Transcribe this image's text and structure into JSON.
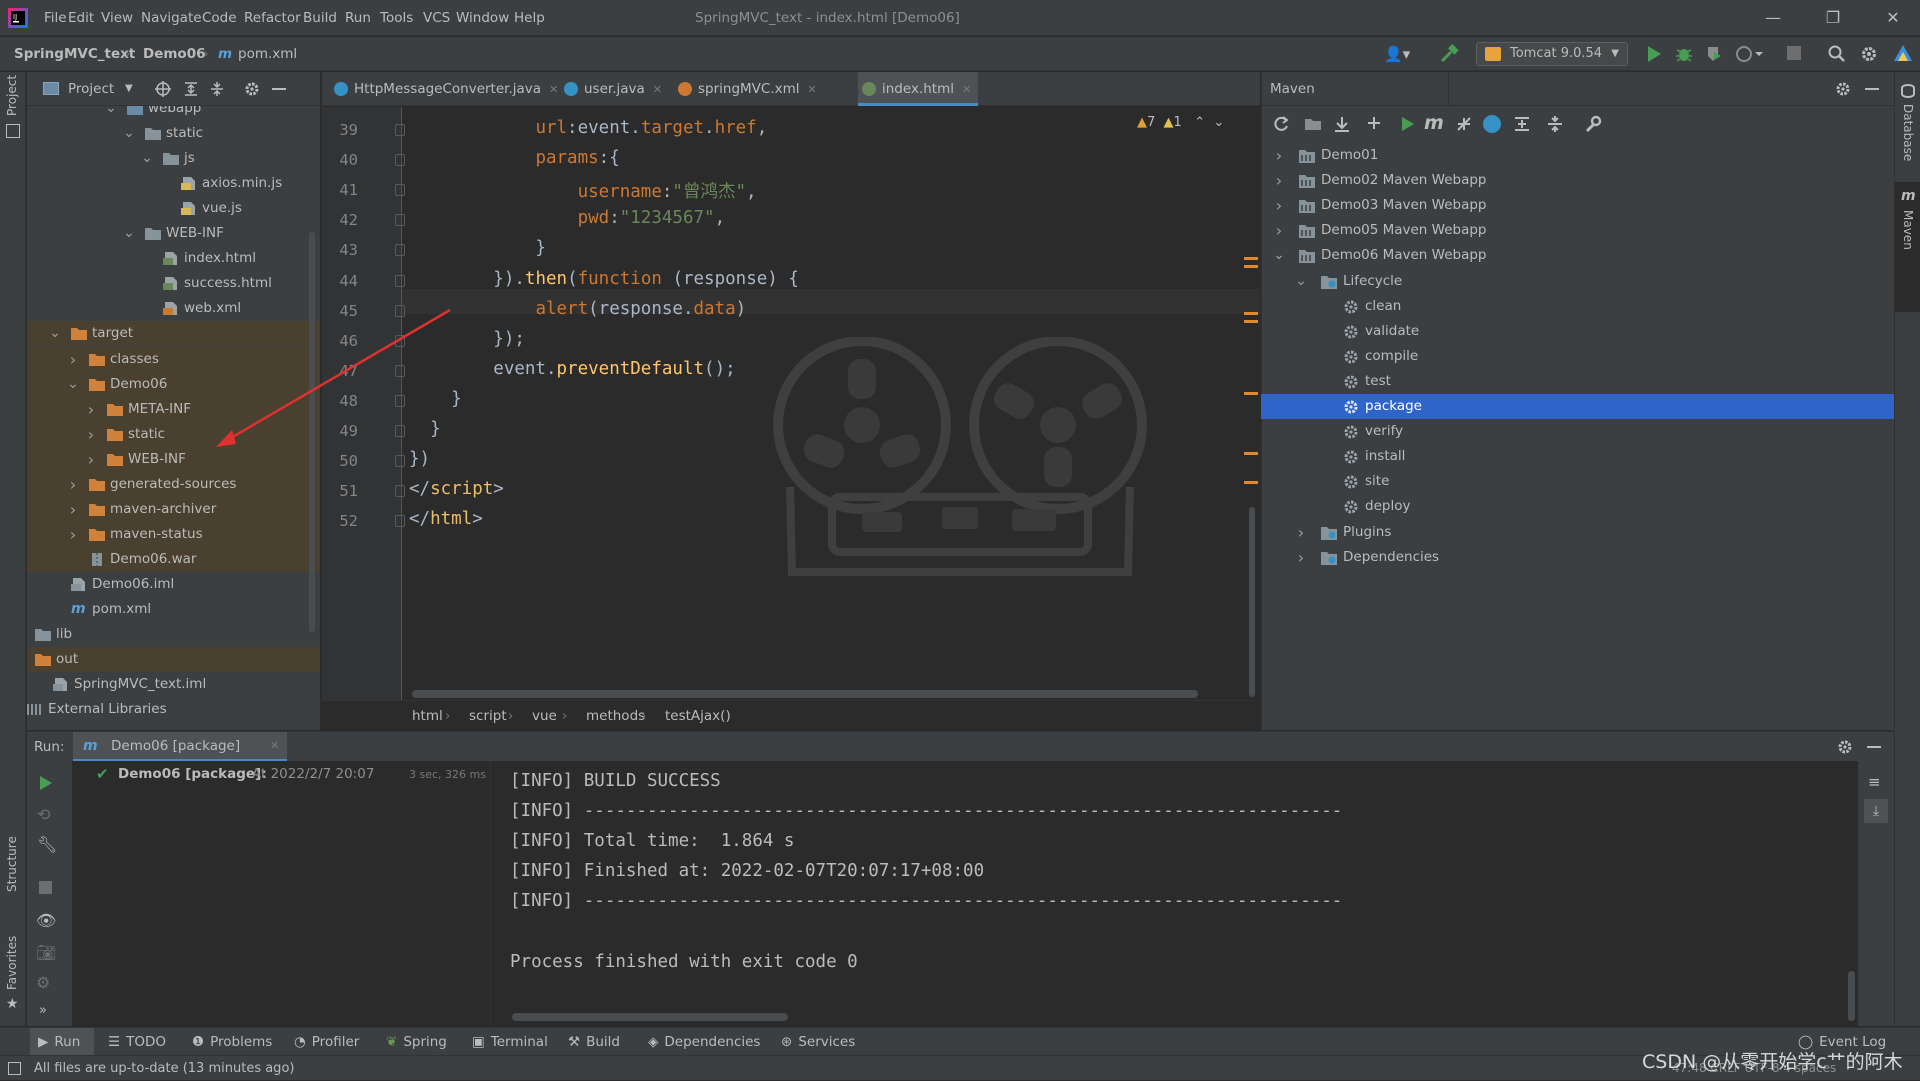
{
  "menu": [
    "File",
    "Edit",
    "View",
    "Navigate",
    "Code",
    "Refactor",
    "Build",
    "Run",
    "Tools",
    "VCS",
    "Window",
    "Help"
  ],
  "window_title": "SpringMVC_text - index.html [Demo06]",
  "nav": {
    "project": "SpringMVC_text",
    "module": "Demo06",
    "file": "pom.xml",
    "run_config": "Tomcat 9.0.54"
  },
  "left_stripe": {
    "project": "Project",
    "structure": "Structure",
    "favorites": "Favorites"
  },
  "right_stripe": {
    "database": "Database",
    "maven": "Maven"
  },
  "project_panel": {
    "title": "Project",
    "rows": [
      {
        "label": "webapp",
        "icon": "folder-web-icon",
        "expanded": true,
        "excluded": false
      },
      {
        "label": "static",
        "icon": "folder-icon",
        "expanded": true,
        "excluded": false
      },
      {
        "label": "js",
        "icon": "folder-icon",
        "expanded": true,
        "excluded": false
      },
      {
        "label": "axios.min.js",
        "icon": "js-file-icon",
        "excluded": false
      },
      {
        "label": "vue.js",
        "icon": "js-file-icon",
        "excluded": false
      },
      {
        "label": "WEB-INF",
        "icon": "folder-icon",
        "expanded": true,
        "excluded": false
      },
      {
        "label": "index.html",
        "icon": "html-file-icon",
        "excluded": false
      },
      {
        "label": "success.html",
        "icon": "html-file-icon",
        "excluded": false
      },
      {
        "label": "web.xml",
        "icon": "xml-file-icon",
        "excluded": false
      },
      {
        "label": "target",
        "icon": "folder-excluded-icon",
        "expanded": true,
        "excluded": true
      },
      {
        "label": "classes",
        "icon": "folder-excluded-icon",
        "expanded": false,
        "excluded": true
      },
      {
        "label": "Demo06",
        "icon": "folder-excluded-icon",
        "expanded": true,
        "excluded": true
      },
      {
        "label": "META-INF",
        "icon": "folder-excluded-icon",
        "expanded": false,
        "excluded": true
      },
      {
        "label": "static",
        "icon": "folder-excluded-icon",
        "expanded": false,
        "excluded": true
      },
      {
        "label": "WEB-INF",
        "icon": "folder-excluded-icon",
        "expanded": false,
        "excluded": true
      },
      {
        "label": "generated-sources",
        "icon": "folder-excluded-icon",
        "expanded": false,
        "excluded": true
      },
      {
        "label": "maven-archiver",
        "icon": "folder-excluded-icon",
        "expanded": false,
        "excluded": true
      },
      {
        "label": "maven-status",
        "icon": "folder-excluded-icon",
        "expanded": false,
        "excluded": true
      },
      {
        "label": "Demo06.war",
        "icon": "archive-file-icon",
        "excluded": true
      },
      {
        "label": "Demo06.iml",
        "icon": "iml-file-icon",
        "excluded": false
      },
      {
        "label": "pom.xml",
        "icon": "maven-file-icon",
        "excluded": false
      },
      {
        "label": "lib",
        "icon": "folder-icon",
        "expanded": false,
        "excluded": false
      },
      {
        "label": "out",
        "icon": "folder-excluded-icon",
        "expanded": false,
        "excluded": true
      },
      {
        "label": "SpringMVC_text.iml",
        "icon": "iml-file-icon",
        "excluded": false
      },
      {
        "label": "External Libraries",
        "icon": "library-icon",
        "expanded": false,
        "excluded": false
      }
    ]
  },
  "tabs": [
    {
      "label": "HttpMessageConverter.java",
      "active": false
    },
    {
      "label": "user.java",
      "active": false
    },
    {
      "label": "springMVC.xml",
      "active": false
    },
    {
      "label": "index.html",
      "active": true
    }
  ],
  "inspections": {
    "warnings": "7",
    "weak": "1"
  },
  "code": [
    {
      "n": "39",
      "tokens": [
        {
          "t": "            "
        },
        {
          "t": "url",
          "c": "k-prop"
        },
        {
          "t": ":event."
        },
        {
          "t": "target",
          "c": "k-prop"
        },
        {
          "t": "."
        },
        {
          "t": "href",
          "c": "k-prop"
        },
        {
          "t": ","
        }
      ]
    },
    {
      "n": "40",
      "tokens": [
        {
          "t": "            "
        },
        {
          "t": "params",
          "c": "k-prop"
        },
        {
          "t": ":{"
        }
      ]
    },
    {
      "n": "41",
      "tokens": [
        {
          "t": "                "
        },
        {
          "t": "username",
          "c": "k-prop"
        },
        {
          "t": ":"
        },
        {
          "t": "\"曾鸿杰\"",
          "c": "k-str"
        },
        {
          "t": ","
        }
      ]
    },
    {
      "n": "42",
      "tokens": [
        {
          "t": "                "
        },
        {
          "t": "pwd",
          "c": "k-prop"
        },
        {
          "t": ":"
        },
        {
          "t": "\"1234567\"",
          "c": "k-str"
        },
        {
          "t": ","
        }
      ]
    },
    {
      "n": "43",
      "tokens": [
        {
          "t": "            }"
        }
      ]
    },
    {
      "n": "44",
      "tokens": [
        {
          "t": "        })."
        },
        {
          "t": "then",
          "c": "k-func"
        },
        {
          "t": "("
        },
        {
          "t": "function",
          "c": "k-kw"
        },
        {
          "t": " (response) {"
        }
      ]
    },
    {
      "n": "45",
      "tokens": [
        {
          "t": "            "
        },
        {
          "t": "alert",
          "c": "k-prop"
        },
        {
          "t": "(response."
        },
        {
          "t": "data",
          "c": "k-prop"
        },
        {
          "t": ")"
        }
      ]
    },
    {
      "n": "46",
      "tokens": [
        {
          "t": "        });"
        }
      ]
    },
    {
      "n": "47",
      "tokens": [
        {
          "t": "        event."
        },
        {
          "t": "preventDefault",
          "c": "k-func"
        },
        {
          "t": "();"
        }
      ]
    },
    {
      "n": "48",
      "tokens": [
        {
          "t": "    }"
        }
      ]
    },
    {
      "n": "49",
      "tokens": [
        {
          "t": "  }"
        }
      ]
    },
    {
      "n": "50",
      "tokens": [
        {
          "t": "})"
        }
      ]
    },
    {
      "n": "51",
      "tokens": [
        {
          "t": "</"
        },
        {
          "t": "script",
          "c": "k-tag"
        },
        {
          "t": ">"
        }
      ]
    },
    {
      "n": "52",
      "tokens": [
        {
          "t": "</"
        },
        {
          "t": "html",
          "c": "k-tag"
        },
        {
          "t": ">"
        }
      ]
    }
  ],
  "breadcrumb": [
    "html",
    "script",
    "vue",
    "methods",
    "testAjax()"
  ],
  "maven": {
    "title": "Maven",
    "rows": [
      {
        "label": "Demo01",
        "level": 0,
        "icon": "maven-module-icon",
        "arrow": "collapsed"
      },
      {
        "label": "Demo02 Maven Webapp",
        "level": 0,
        "icon": "maven-module-icon",
        "arrow": "collapsed"
      },
      {
        "label": "Demo03 Maven Webapp",
        "level": 0,
        "icon": "maven-module-icon",
        "arrow": "collapsed"
      },
      {
        "label": "Demo05 Maven Webapp",
        "level": 0,
        "icon": "maven-module-icon",
        "arrow": "collapsed"
      },
      {
        "label": "Demo06 Maven Webapp",
        "level": 0,
        "icon": "maven-module-icon",
        "arrow": "expanded"
      },
      {
        "label": "Lifecycle",
        "level": 1,
        "icon": "lifecycle-folder-icon",
        "arrow": "expanded"
      },
      {
        "label": "clean",
        "level": 2,
        "icon": "gear-icon"
      },
      {
        "label": "validate",
        "level": 2,
        "icon": "gear-icon"
      },
      {
        "label": "compile",
        "level": 2,
        "icon": "gear-icon"
      },
      {
        "label": "test",
        "level": 2,
        "icon": "gear-icon"
      },
      {
        "label": "package",
        "level": 2,
        "icon": "gear-icon",
        "selected": true
      },
      {
        "label": "verify",
        "level": 2,
        "icon": "gear-icon"
      },
      {
        "label": "install",
        "level": 2,
        "icon": "gear-icon"
      },
      {
        "label": "site",
        "level": 2,
        "icon": "gear-icon"
      },
      {
        "label": "deploy",
        "level": 2,
        "icon": "gear-icon"
      },
      {
        "label": "Plugins",
        "level": 1,
        "icon": "plugins-folder-icon",
        "arrow": "collapsed"
      },
      {
        "label": "Dependencies",
        "level": 1,
        "icon": "dependencies-folder-icon",
        "arrow": "collapsed"
      }
    ]
  },
  "run": {
    "label": "Run:",
    "tab": "Demo06 [package]",
    "tree_item": "Demo06 [package]:",
    "tree_time": "At 2022/2/7 20:07",
    "duration": "3 sec, 326 ms",
    "console": [
      "[INFO] BUILD SUCCESS",
      "[INFO] ------------------------------------------------------------------------",
      "[INFO] Total time:  1.864 s",
      "[INFO] Finished at: 2022-02-07T20:07:17+08:00",
      "[INFO] ------------------------------------------------------------------------",
      "",
      "Process finished with exit code 0"
    ]
  },
  "toolwindows": [
    "Run",
    "TODO",
    "Problems",
    "Profiler",
    "Spring",
    "Terminal",
    "Build",
    "Dependencies",
    "Services"
  ],
  "event_log": "Event Log",
  "status": "All files are up-to-date (13 minutes ago)",
  "status_right": "47:48  CRLF  UTF-8  4 spaces",
  "watermark": "CSDN @从零开始学c艹的阿木",
  "colors": {
    "accent": "#4a88c7",
    "selection": "#2f65ca",
    "excluded": "#49402f",
    "folder_excluded": "#d0813a",
    "success": "#499c54"
  }
}
